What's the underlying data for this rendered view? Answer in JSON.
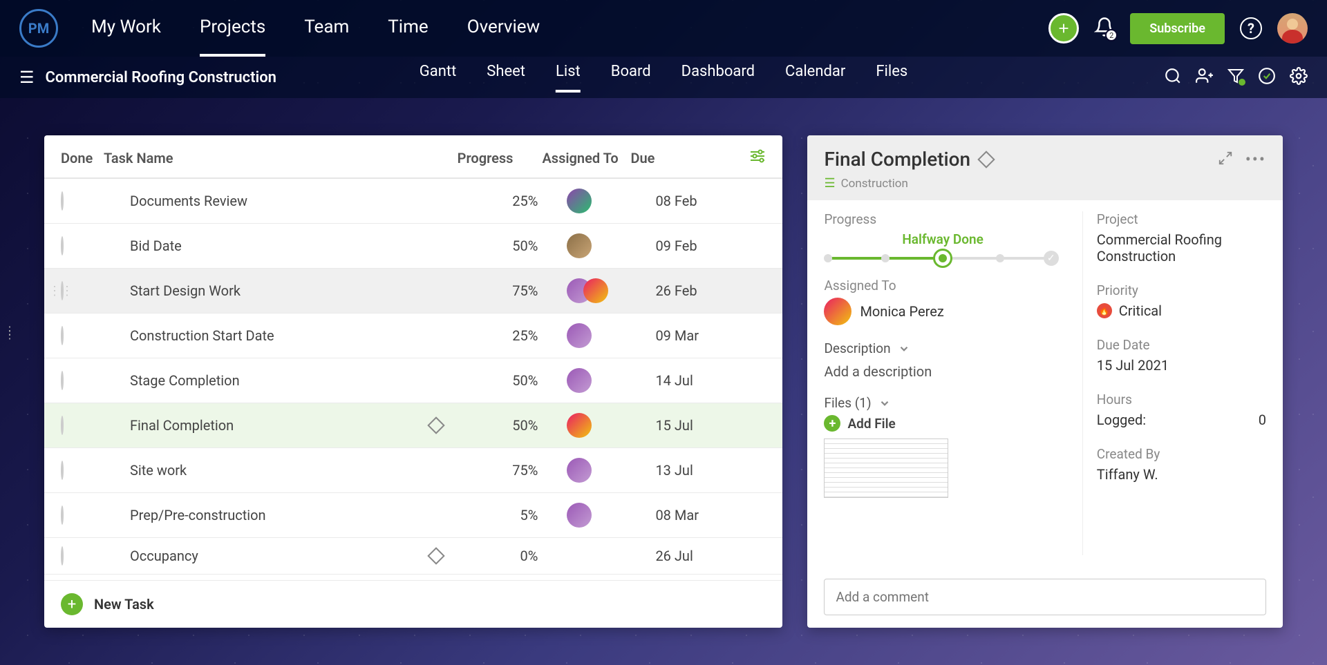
{
  "nav": {
    "logo": "PM",
    "items": [
      "My Work",
      "Projects",
      "Team",
      "Time",
      "Overview"
    ],
    "active": "Projects",
    "subscribe": "Subscribe",
    "notifications": "2"
  },
  "project": {
    "title": "Commercial Roofing Construction",
    "views": [
      "Gantt",
      "Sheet",
      "List",
      "Board",
      "Dashboard",
      "Calendar",
      "Files"
    ],
    "active_view": "List"
  },
  "task_table": {
    "columns": {
      "done": "Done",
      "name": "Task Name",
      "progress": "Progress",
      "assigned": "Assigned To",
      "due": "Due"
    },
    "rows": [
      {
        "name": "Documents Review",
        "progress": "25%",
        "due": "08 Feb",
        "avatars": [
          "green"
        ],
        "milestone": false
      },
      {
        "name": "Bid Date",
        "progress": "50%",
        "due": "09 Feb",
        "avatars": [
          "brown"
        ],
        "milestone": false
      },
      {
        "name": "Start Design Work",
        "progress": "75%",
        "due": "26 Feb",
        "avatars": [
          "purple",
          "yellow"
        ],
        "milestone": false,
        "hovered": true
      },
      {
        "name": "Construction Start Date",
        "progress": "25%",
        "due": "09 Mar",
        "avatars": [
          "purple"
        ],
        "milestone": false
      },
      {
        "name": "Stage Completion",
        "progress": "50%",
        "due": "14 Jul",
        "avatars": [
          "purple"
        ],
        "milestone": false
      },
      {
        "name": "Final Completion",
        "progress": "50%",
        "due": "15 Jul",
        "avatars": [
          "yellow"
        ],
        "milestone": true,
        "active": true
      },
      {
        "name": "Site work",
        "progress": "75%",
        "due": "13 Jul",
        "avatars": [
          "purple"
        ],
        "milestone": false
      },
      {
        "name": "Prep/Pre-construction",
        "progress": "5%",
        "due": "08 Mar",
        "avatars": [
          "purple"
        ],
        "milestone": false
      },
      {
        "name": "Occupancy",
        "progress": "0%",
        "due": "26 Jul",
        "avatars": [],
        "milestone": true
      }
    ],
    "new_task": "New Task"
  },
  "detail": {
    "title": "Final Completion",
    "breadcrumb": "Construction",
    "progress_label_title": "Progress",
    "progress_label": "Halfway Done",
    "assigned_label": "Assigned To",
    "assignee": "Monica Perez",
    "description_label": "Description",
    "description_placeholder": "Add a description",
    "files_label": "Files (1)",
    "add_file": "Add File",
    "project_label": "Project",
    "project_value": "Commercial Roofing Construction",
    "priority_label": "Priority",
    "priority_value": "Critical",
    "due_label": "Due Date",
    "due_value": "15 Jul 2021",
    "hours_label": "Hours",
    "hours_logged_label": "Logged:",
    "hours_logged_value": "0",
    "created_label": "Created By",
    "created_value": "Tiffany W.",
    "comment_placeholder": "Add a comment"
  }
}
